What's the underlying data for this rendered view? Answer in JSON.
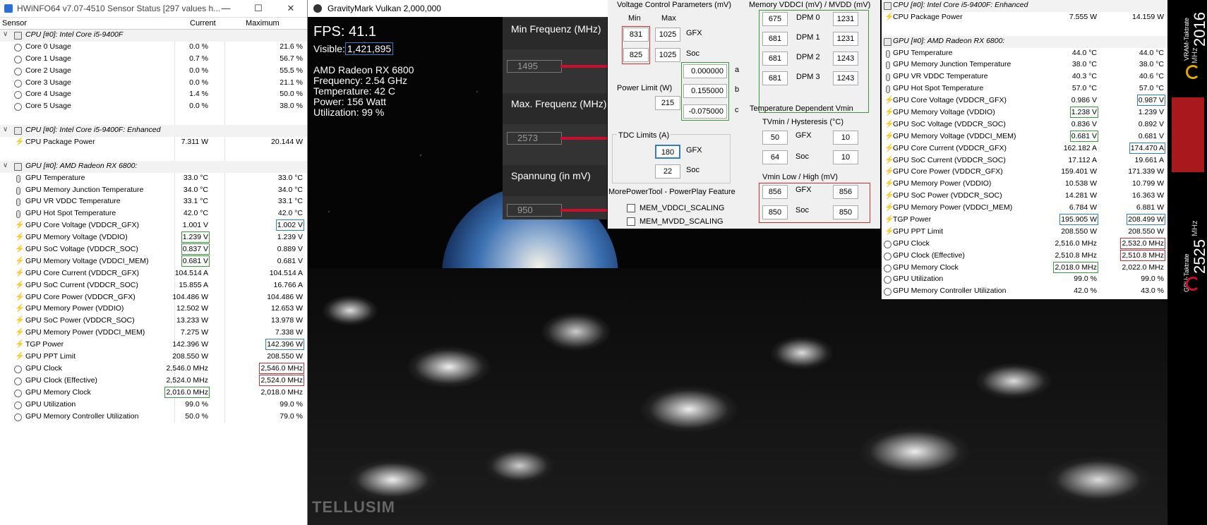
{
  "left_hwinfo": {
    "title": "HWiNFO64 v7.07-4510 Sensor Status [297 values h...",
    "columns": [
      "Sensor",
      "Current",
      "Maximum"
    ],
    "rows": [
      {
        "type": "group",
        "name": "CPU [#0]: Intel Core i5-9400F"
      },
      {
        "name": "Core 0 Usage",
        "cur": "0.0 %",
        "max": "21.6 %",
        "ic": "gauge"
      },
      {
        "name": "Core 1 Usage",
        "cur": "0.7 %",
        "max": "56.7 %",
        "ic": "gauge"
      },
      {
        "name": "Core 2 Usage",
        "cur": "0.0 %",
        "max": "55.5 %",
        "ic": "gauge"
      },
      {
        "name": "Core 3 Usage",
        "cur": "0.0 %",
        "max": "21.1 %",
        "ic": "gauge"
      },
      {
        "name": "Core 4 Usage",
        "cur": "1.4 %",
        "max": "50.0 %",
        "ic": "gauge"
      },
      {
        "name": "Core 5 Usage",
        "cur": "0.0 %",
        "max": "38.0 %",
        "ic": "gauge"
      },
      {
        "type": "blank"
      },
      {
        "type": "group",
        "name": "CPU [#0]: Intel Core i5-9400F: Enhanced"
      },
      {
        "name": "CPU Package Power",
        "cur": "7.311 W",
        "max": "20.144 W",
        "ic": "bolt"
      },
      {
        "type": "blank"
      },
      {
        "type": "group",
        "name": "GPU [#0]: AMD Radeon RX 6800:"
      },
      {
        "name": "GPU Temperature",
        "cur": "33.0 °C",
        "max": "33.0 °C",
        "ic": "temp"
      },
      {
        "name": "GPU Memory Junction Temperature",
        "cur": "34.0 °C",
        "max": "34.0 °C",
        "ic": "temp"
      },
      {
        "name": "GPU VR VDDC Temperature",
        "cur": "33.1 °C",
        "max": "33.1 °C",
        "ic": "temp"
      },
      {
        "name": "GPU Hot Spot Temperature",
        "cur": "42.0 °C",
        "max": "42.0 °C",
        "ic": "temp"
      },
      {
        "name": "GPU Core Voltage (VDDCR_GFX)",
        "cur": "1.001 V",
        "max": "1.002 V",
        "ic": "bolt",
        "maxbox": "b"
      },
      {
        "name": "GPU Memory Voltage (VDDIO)",
        "cur": "1.239 V",
        "max": "1.239 V",
        "ic": "bolt",
        "curbox": "g"
      },
      {
        "name": "GPU SoC Voltage (VDDCR_SOC)",
        "cur": "0.837 V",
        "max": "0.889 V",
        "ic": "bolt",
        "curbox": "g"
      },
      {
        "name": "GPU Memory Voltage (VDDCI_MEM)",
        "cur": "0.681 V",
        "max": "0.681 V",
        "ic": "bolt",
        "curbox": "g"
      },
      {
        "name": "GPU Core Current (VDDCR_GFX)",
        "cur": "104.514 A",
        "max": "104.514 A",
        "ic": "bolt"
      },
      {
        "name": "GPU SoC Current (VDDCR_SOC)",
        "cur": "15.855 A",
        "max": "16.766 A",
        "ic": "bolt"
      },
      {
        "name": "GPU Core Power (VDDCR_GFX)",
        "cur": "104.486 W",
        "max": "104.486 W",
        "ic": "bolt"
      },
      {
        "name": "GPU Memory Power (VDDIO)",
        "cur": "12.502 W",
        "max": "12.653 W",
        "ic": "bolt"
      },
      {
        "name": "GPU SoC Power (VDDCR_SOC)",
        "cur": "13.233 W",
        "max": "13.978 W",
        "ic": "bolt"
      },
      {
        "name": "GPU Memory Power (VDDCI_MEM)",
        "cur": "7.275 W",
        "max": "7.338 W",
        "ic": "bolt"
      },
      {
        "name": "TGP Power",
        "cur": "142.396 W",
        "max": "142.396 W",
        "ic": "bolt",
        "maxbox": "b"
      },
      {
        "name": "GPU PPT Limit",
        "cur": "208.550 W",
        "max": "208.550 W",
        "ic": "bolt"
      },
      {
        "name": "GPU Clock",
        "cur": "2,546.0 MHz",
        "max": "2,546.0 MHz",
        "ic": "gauge",
        "maxbox": "r"
      },
      {
        "name": "GPU Clock (Effective)",
        "cur": "2,524.0 MHz",
        "max": "2,524.0 MHz",
        "ic": "gauge",
        "maxbox": "r"
      },
      {
        "name": "GPU Memory Clock",
        "cur": "2,016.0 MHz",
        "max": "2,018.0 MHz",
        "ic": "gauge",
        "curbox": "g"
      },
      {
        "name": "GPU Utilization",
        "cur": "99.0 %",
        "max": "99.0 %",
        "ic": "gauge"
      },
      {
        "name": "GPU Memory Controller Utilization",
        "cur": "50.0 %",
        "max": "79.0 %",
        "ic": "gauge"
      }
    ]
  },
  "gravitymark": {
    "title": "GravityMark Vulkan 2,000,000",
    "fps": "FPS: 41.1",
    "visible_label": "Visible:",
    "visible_value": "1,421,895",
    "gpu": "AMD Radeon RX 6800",
    "frequency": "Frequency: 2.54 GHz",
    "temperature": "Temperature: 42 C",
    "power": "Power: 156 Watt",
    "utilization": "Utilization: 99 %",
    "watermark": "TELLUSIM"
  },
  "freq_panel": {
    "min_label": "Min Frequenz (MHz)",
    "min_value": "1495",
    "max_label": "Max. Frequenz (MHz)",
    "max_value": "2573",
    "volt_label": "Spannung (in mV)",
    "volt_value": "950"
  },
  "mpt": {
    "vcp_title": "Voltage Control Parameters (mV)",
    "min": "Min",
    "max": "Max",
    "gfx_min": "831",
    "gfx_max": "1025",
    "gfx": "GFX",
    "soc_min": "825",
    "soc_max": "1025",
    "soc": "Soc",
    "coef_a": "0.000000",
    "coef_b": "0.155000",
    "coef_c": "-0.075000",
    "a": "a",
    "b": "b",
    "c": "c",
    "power_limit_label": "Power Limit (W)",
    "power_limit": "215",
    "tdc_label": "TDC Limits (A)",
    "tdc_gfx": "180",
    "tdc_soc": "22",
    "mpt_title": "MorePowerTool - PowerPlay Feature",
    "cb1": "MEM_VDDCI_SCALING",
    "cb2": "MEM_MVDD_SCALING",
    "mem_title": "Memory VDDCI (mV) / MVDD (mV)",
    "dpm": [
      {
        "l": "675",
        "label": "DPM 0",
        "r": "1231"
      },
      {
        "l": "681",
        "label": "DPM 1",
        "r": "1231"
      },
      {
        "l": "681",
        "label": "DPM 2",
        "r": "1243"
      },
      {
        "l": "681",
        "label": "DPM 3",
        "r": "1243"
      }
    ],
    "tdv_title": "Temperature Dependent Vmin",
    "tvmin_label": "TVmin / Hysteresis (°C)",
    "tv_gfx_l": "50",
    "tv_gfx_r": "10",
    "tv_soc_l": "64",
    "tv_soc_r": "10",
    "vmin_label": "Vmin Low / High (mV)",
    "vm_gfx_l": "856",
    "vm_gfx_r": "856",
    "vm_soc_l": "850",
    "vm_soc_r": "850"
  },
  "right_hwinfo": {
    "rows": [
      {
        "type": "group",
        "name": "CPU [#0]: Intel Core i5-9400F: Enhanced"
      },
      {
        "name": "CPU Package Power",
        "cur": "7.555 W",
        "max": "14.159 W",
        "ic": "bolt"
      },
      {
        "type": "blank"
      },
      {
        "type": "group",
        "name": "GPU [#0]: AMD Radeon RX 6800:"
      },
      {
        "name": "GPU Temperature",
        "cur": "44.0 °C",
        "max": "44.0 °C",
        "ic": "temp"
      },
      {
        "name": "GPU Memory Junction Temperature",
        "cur": "38.0 °C",
        "max": "38.0 °C",
        "ic": "temp"
      },
      {
        "name": "GPU VR VDDC Temperature",
        "cur": "40.3 °C",
        "max": "40.6 °C",
        "ic": "temp"
      },
      {
        "name": "GPU Hot Spot Temperature",
        "cur": "57.0 °C",
        "max": "57.0 °C",
        "ic": "temp"
      },
      {
        "name": "GPU Core Voltage (VDDCR_GFX)",
        "cur": "0.986 V",
        "max": "0.987 V",
        "ic": "bolt",
        "maxbox": "b"
      },
      {
        "name": "GPU Memory Voltage (VDDIO)",
        "cur": "1.238 V",
        "max": "1.239 V",
        "ic": "bolt",
        "curbox": "g"
      },
      {
        "name": "GPU SoC Voltage (VDDCR_SOC)",
        "cur": "0.836 V",
        "max": "0.892 V",
        "ic": "bolt"
      },
      {
        "name": "GPU Memory Voltage (VDDCI_MEM)",
        "cur": "0.681 V",
        "max": "0.681 V",
        "ic": "bolt",
        "curbox": "g"
      },
      {
        "name": "GPU Core Current (VDDCR_GFX)",
        "cur": "162.182 A",
        "max": "174.470 A",
        "ic": "bolt",
        "maxbox": "b"
      },
      {
        "name": "GPU SoC Current (VDDCR_SOC)",
        "cur": "17.112 A",
        "max": "19.661 A",
        "ic": "bolt"
      },
      {
        "name": "GPU Core Power (VDDCR_GFX)",
        "cur": "159.401 W",
        "max": "171.339 W",
        "ic": "bolt"
      },
      {
        "name": "GPU Memory Power (VDDIO)",
        "cur": "10.538 W",
        "max": "10.799 W",
        "ic": "bolt"
      },
      {
        "name": "GPU SoC Power (VDDCR_SOC)",
        "cur": "14.281 W",
        "max": "16.363 W",
        "ic": "bolt"
      },
      {
        "name": "GPU Memory Power (VDDCI_MEM)",
        "cur": "6.784 W",
        "max": "6.881 W",
        "ic": "bolt"
      },
      {
        "name": "TGP Power",
        "cur": "195.905 W",
        "max": "208.499 W",
        "ic": "bolt",
        "curbox": "b",
        "maxbox": "b"
      },
      {
        "name": "GPU PPT Limit",
        "cur": "208.550 W",
        "max": "208.550 W",
        "ic": "bolt"
      },
      {
        "name": "GPU Clock",
        "cur": "2,516.0 MHz",
        "max": "2,532.0 MHz",
        "ic": "gauge",
        "maxbox": "r"
      },
      {
        "name": "GPU Clock (Effective)",
        "cur": "2,510.8 MHz",
        "max": "2,510.8 MHz",
        "ic": "gauge",
        "maxbox": "r"
      },
      {
        "name": "GPU Memory Clock",
        "cur": "2,018.0 MHz",
        "max": "2,022.0 MHz",
        "ic": "gauge",
        "curbox": "g"
      },
      {
        "name": "GPU Utilization",
        "cur": "99.0 %",
        "max": "99.0 %",
        "ic": "gauge"
      },
      {
        "name": "GPU Memory Controller Utilization",
        "cur": "42.0 %",
        "max": "43.0 %",
        "ic": "gauge"
      }
    ]
  },
  "strip": {
    "vram_label": "VRAM-Taktrate",
    "vram_value": "2016",
    "gpu_label": "GPU-Taktrate",
    "gpu_value": "2525",
    "unit": "MHz"
  }
}
